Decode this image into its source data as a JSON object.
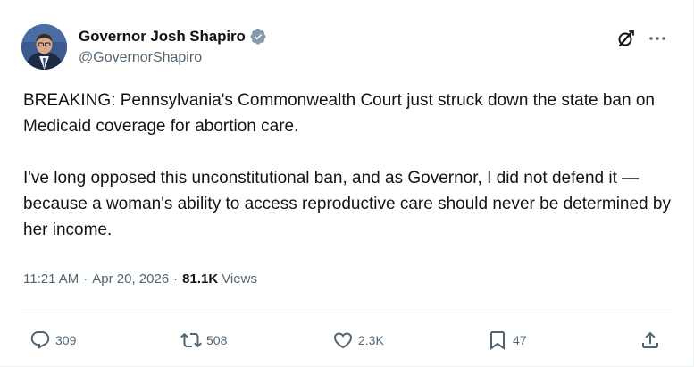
{
  "tweet": {
    "author_name": "Governor Josh Shapiro",
    "author_handle": "@GovernorShapiro",
    "paragraph_1": "BREAKING: Pennsylvania's Commonwealth Court just struck down the state ban on Medicaid coverage for abortion care.",
    "paragraph_2": "I've long opposed this unconstitutional ban, and as Governor, I did not defend it — because a woman's ability to access reproductive care should never be determined by her income.",
    "time": "11:21 AM",
    "date": "Apr 20, 2026",
    "separator": "·",
    "views_count": "81.1K",
    "views_label": "Views"
  },
  "actions": {
    "replies": "309",
    "reposts": "508",
    "likes": "2.3K",
    "bookmarks": "47"
  },
  "colors": {
    "verified": "#829aab",
    "text": "#0f1419",
    "muted": "#536471",
    "divider": "#eff3f4"
  },
  "icons": [
    "verified-badge-icon",
    "grok-icon",
    "more-icon",
    "reply-icon",
    "repost-icon",
    "like-icon",
    "bookmark-icon",
    "share-icon"
  ]
}
